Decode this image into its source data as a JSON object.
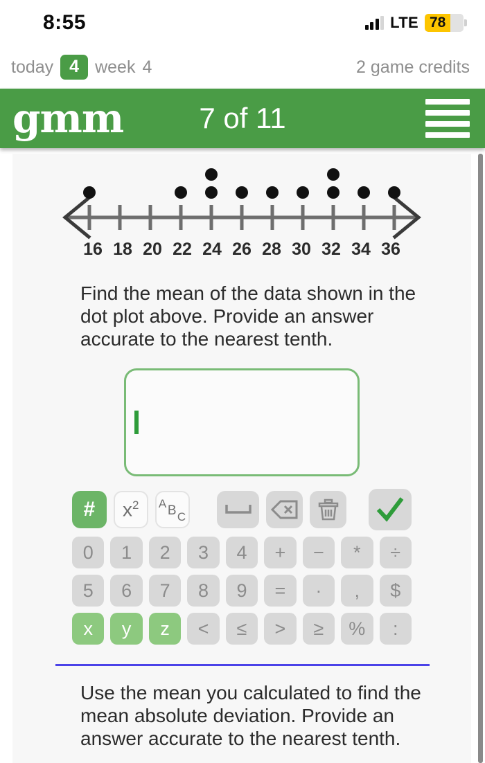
{
  "status_bar": {
    "time": "8:55",
    "network": "LTE",
    "battery_percent": "78",
    "signal_icon": "signal-bars-icon",
    "battery_icon": "battery-icon"
  },
  "stats_bar": {
    "today_label": "today",
    "today_value": "4",
    "week_label": "week",
    "week_value": "4",
    "credits": "2 game credits"
  },
  "app_bar": {
    "logo": "gmm",
    "progress": "7 of 11",
    "menu_icon": "hamburger-menu-icon",
    "brand_color": "#4a9c46"
  },
  "chart_data": {
    "type": "scatter",
    "subtype": "dot-plot",
    "title": "",
    "xlabel": "",
    "ylabel": "",
    "categories": [
      "16",
      "18",
      "20",
      "22",
      "24",
      "26",
      "28",
      "30",
      "32",
      "34",
      "36"
    ],
    "values": [
      1,
      0,
      0,
      1,
      2,
      1,
      1,
      1,
      2,
      1,
      1
    ],
    "tick_labels": [
      "16",
      "18",
      "20",
      "22",
      "24",
      "26",
      "28",
      "30",
      "32",
      "34",
      "36"
    ],
    "xlim": [
      16,
      36
    ],
    "axis_style": "double-arrow-number-line",
    "grid": false,
    "legend": "none",
    "dot_color": "#111111",
    "axis_color": "#6e6e6e",
    "total_dots": 11
  },
  "question_1": {
    "text": "Find the mean of the data shown in the dot plot above. Provide an answer accurate to the nearest tenth."
  },
  "answer_input": {
    "value": "",
    "placeholder": "",
    "border_color": "#79bb76",
    "caret_color": "#2e9c3a"
  },
  "keyboard": {
    "toolbar": [
      {
        "name": "number-mode-button",
        "label": "#",
        "style": "green"
      },
      {
        "name": "exponent-button",
        "label": "x²",
        "style": "white"
      },
      {
        "name": "alpha-mode-button",
        "label": "ABC",
        "style": "white"
      },
      {
        "name": "space-button",
        "label": "␣",
        "style": "gray"
      },
      {
        "name": "backspace-button",
        "label": "⌫",
        "style": "gray"
      },
      {
        "name": "clear-all-button",
        "label": "🗑",
        "style": "gray"
      },
      {
        "name": "submit-button",
        "label": "✓",
        "style": "check"
      }
    ],
    "row_1": [
      "0",
      "1",
      "2",
      "3",
      "4",
      "+",
      "−",
      "*",
      "÷"
    ],
    "row_2": [
      "5",
      "6",
      "7",
      "8",
      "9",
      "=",
      "·",
      ",",
      "$"
    ],
    "row_3": [
      "x",
      "y",
      "z",
      "<",
      "≤",
      ">",
      "≥",
      "%",
      ":"
    ],
    "variable_keys": [
      "x",
      "y",
      "z"
    ],
    "variable_key_color": "#8dc97f",
    "key_color": "#d8d8d8"
  },
  "divider": {
    "color": "#4b43e8"
  },
  "question_2": {
    "text": "Use the mean you calculated to find the mean absolute deviation. Provide an answer accurate to the nearest tenth."
  }
}
